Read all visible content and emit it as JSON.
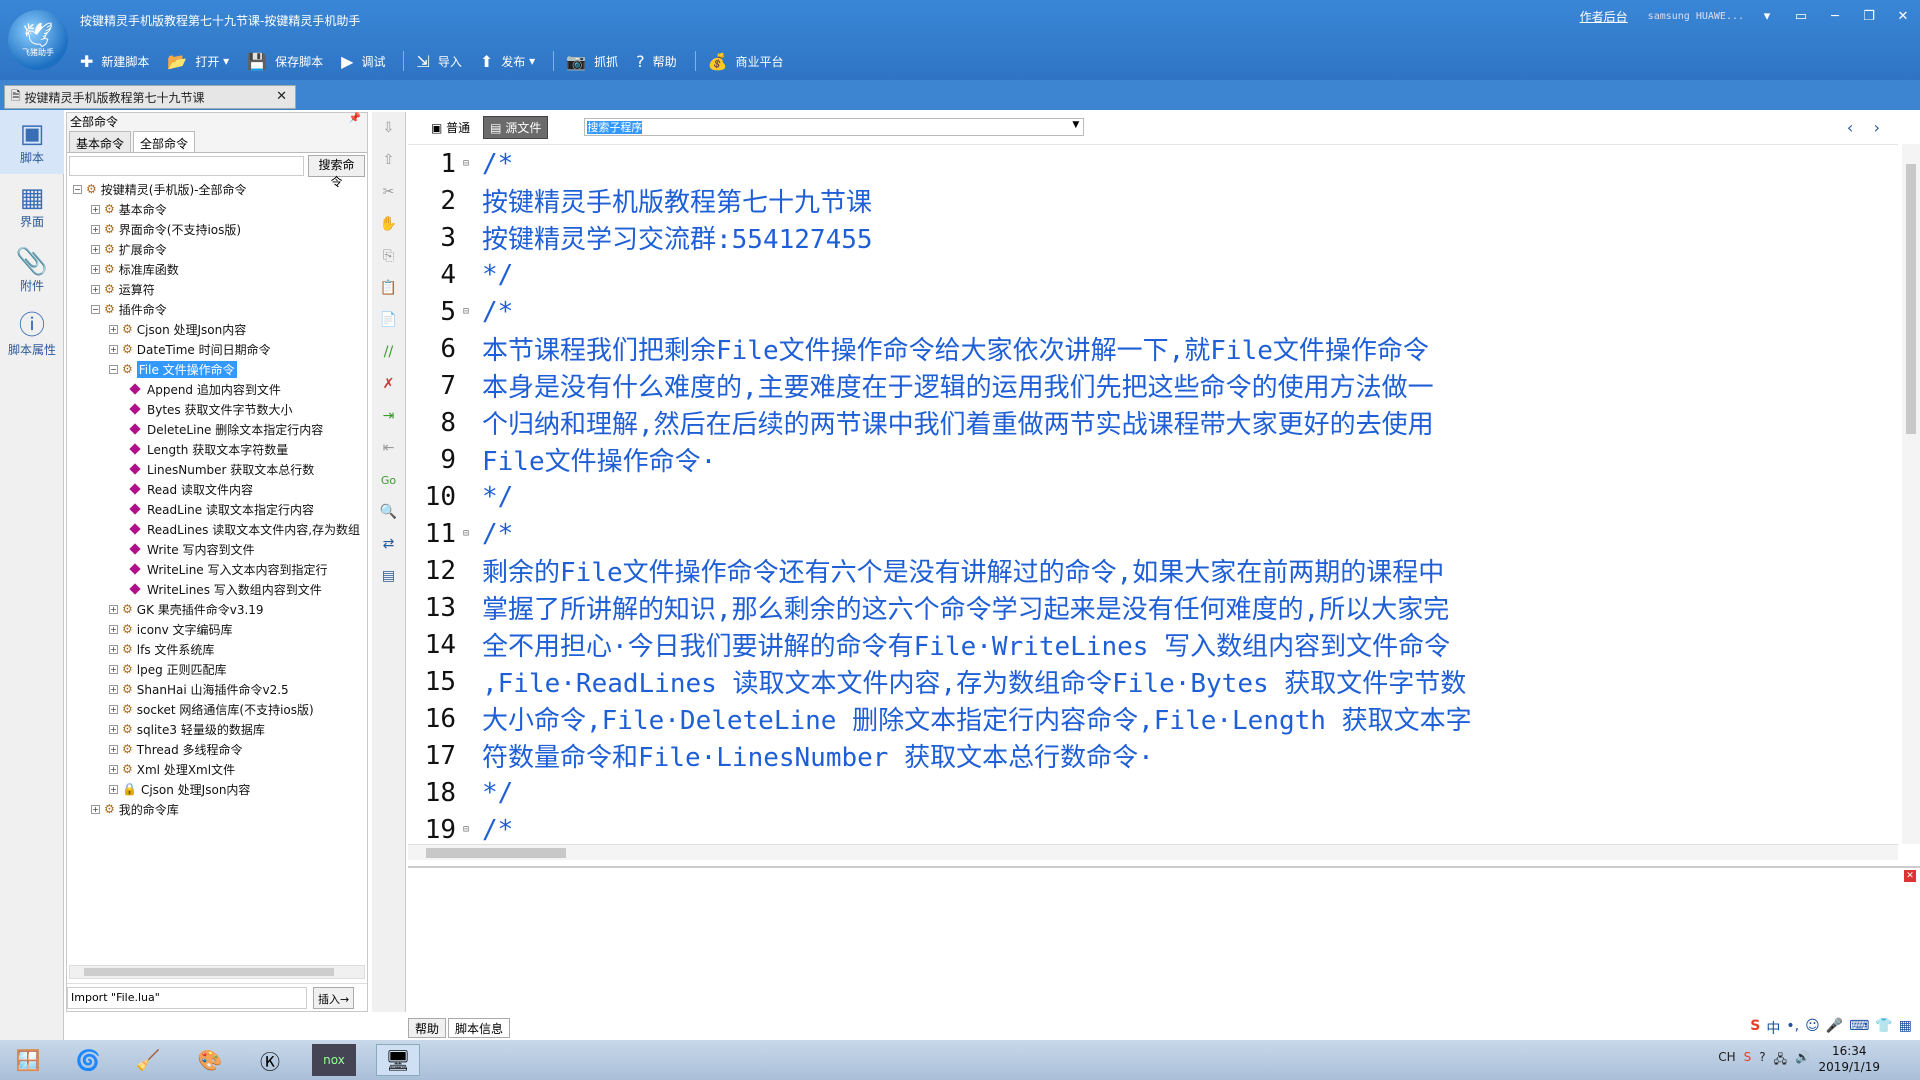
{
  "window": {
    "title": "按键精灵手机版教程第七十九节课-按键精灵手机助手",
    "logo_text": "飞猪助手",
    "author_link": "作者后台",
    "device": "samsung HUAWE...",
    "min": "─",
    "restore": "❐",
    "max": "□",
    "close": "✕",
    "extra": "▭"
  },
  "toolbar": {
    "new": "新建脚本",
    "open": "打开",
    "save": "保存脚本",
    "debug": "调试",
    "import": "导入",
    "publish": "发布",
    "capture": "抓抓",
    "help": "帮助",
    "market": "商业平台"
  },
  "doc_tab": {
    "label": "按键精灵手机版教程第七十九节课"
  },
  "rail": {
    "script": "脚本",
    "ui": "界面",
    "attach": "附件",
    "props": "脚本属性"
  },
  "commands": {
    "header": "全部命令",
    "tab_basic": "基本命令",
    "tab_all": "全部命令",
    "search_button": "搜索命令",
    "tree": [
      {
        "label": "按键精灵(手机版)-全部命令",
        "level": 0,
        "type": "root"
      },
      {
        "label": "基本命令",
        "level": 1,
        "type": "folder"
      },
      {
        "label": "界面命令(不支持ios版)",
        "level": 1,
        "type": "folder"
      },
      {
        "label": "扩展命令",
        "level": 1,
        "type": "folder"
      },
      {
        "label": "标准库函数",
        "level": 1,
        "type": "folder"
      },
      {
        "label": "运算符",
        "level": 1,
        "type": "folder"
      },
      {
        "label": "插件命令",
        "level": 1,
        "type": "open"
      },
      {
        "label": "Cjson 处理Json内容",
        "level": 2,
        "type": "folder"
      },
      {
        "label": "DateTime 时间日期命令",
        "level": 2,
        "type": "folder"
      },
      {
        "label": "File 文件操作命令",
        "level": 2,
        "type": "selected"
      },
      {
        "label": "Append 追加内容到文件",
        "level": 3,
        "type": "leaf"
      },
      {
        "label": "Bytes 获取文件字节数大小",
        "level": 3,
        "type": "leaf"
      },
      {
        "label": "DeleteLine 删除文本指定行内容",
        "level": 3,
        "type": "leaf"
      },
      {
        "label": "Length 获取文本字符数量",
        "level": 3,
        "type": "leaf"
      },
      {
        "label": "LinesNumber 获取文本总行数",
        "level": 3,
        "type": "leaf"
      },
      {
        "label": "Read 读取文件内容",
        "level": 3,
        "type": "leaf"
      },
      {
        "label": "ReadLine 读取文本指定行内容",
        "level": 3,
        "type": "leaf"
      },
      {
        "label": "ReadLines 读取文本文件内容,存为数组",
        "level": 3,
        "type": "leaf"
      },
      {
        "label": "Write 写内容到文件",
        "level": 3,
        "type": "leaf"
      },
      {
        "label": "WriteLine 写入文本内容到指定行",
        "level": 3,
        "type": "leaf"
      },
      {
        "label": "WriteLines 写入数组内容到文件",
        "level": 3,
        "type": "leaf"
      },
      {
        "label": "GK 果壳插件命令v3.19",
        "level": 2,
        "type": "folder"
      },
      {
        "label": "iconv 文字编码库",
        "level": 2,
        "type": "folder"
      },
      {
        "label": "lfs 文件系统库",
        "level": 2,
        "type": "folder"
      },
      {
        "label": "lpeg 正则匹配库",
        "level": 2,
        "type": "folder"
      },
      {
        "label": "ShanHai 山海插件命令v2.5",
        "level": 2,
        "type": "folder"
      },
      {
        "label": "socket 网络通信库(不支持ios版)",
        "level": 2,
        "type": "folder"
      },
      {
        "label": "sqlite3 轻量级的数据库",
        "level": 2,
        "type": "folder"
      },
      {
        "label": "Thread 多线程命令",
        "level": 2,
        "type": "folder"
      },
      {
        "label": "Xml 处理Xml文件",
        "level": 2,
        "type": "folder"
      },
      {
        "label": "Cjson 处理Json内容",
        "level": 2,
        "type": "lock"
      },
      {
        "label": "我的命令库",
        "level": 1,
        "type": "folder"
      }
    ],
    "import_text": "Import \"File.lua\"",
    "insert_button": "插入→"
  },
  "editor": {
    "mode_normal": "普通",
    "mode_source": "源文件",
    "func_select": "搜索子程序",
    "lines": [
      {
        "n": "1",
        "fold": "⊟",
        "text": "/*"
      },
      {
        "n": "2",
        "fold": "",
        "text": "按键精灵手机版教程第七十九节课"
      },
      {
        "n": "3",
        "fold": "",
        "text": "按键精灵学习交流群:554127455"
      },
      {
        "n": "4",
        "fold": "",
        "text": "*/"
      },
      {
        "n": "5",
        "fold": "⊟",
        "text": "/*"
      },
      {
        "n": "6",
        "fold": "",
        "text": "本节课程我们把剩余File文件操作命令给大家依次讲解一下,就File文件操作命令"
      },
      {
        "n": "7",
        "fold": "",
        "text": "本身是没有什么难度的,主要难度在于逻辑的运用我们先把这些命令的使用方法做一"
      },
      {
        "n": "8",
        "fold": "",
        "text": "个归纳和理解,然后在后续的两节课中我们着重做两节实战课程带大家更好的去使用"
      },
      {
        "n": "9",
        "fold": "",
        "text": "File文件操作命令·"
      },
      {
        "n": "10",
        "fold": "",
        "text": "*/"
      },
      {
        "n": "11",
        "fold": "⊟",
        "text": "/*"
      },
      {
        "n": "12",
        "fold": "",
        "text": "剩余的File文件操作命令还有六个是没有讲解过的命令,如果大家在前两期的课程中"
      },
      {
        "n": "13",
        "fold": "",
        "text": "掌握了所讲解的知识,那么剩余的这六个命令学习起来是没有任何难度的,所以大家完"
      },
      {
        "n": "14",
        "fold": "",
        "text": "全不用担心·今日我们要讲解的命令有File·WriteLines 写入数组内容到文件命令"
      },
      {
        "n": "15",
        "fold": "",
        "text": ",File·ReadLines 读取文本文件内容,存为数组命令File·Bytes 获取文件字节数"
      },
      {
        "n": "16",
        "fold": "",
        "text": "大小命令,File·DeleteLine 删除文本指定行内容命令,File·Length 获取文本字"
      },
      {
        "n": "17",
        "fold": "",
        "text": "符数量命令和File·LinesNumber 获取文本总行数命令·"
      },
      {
        "n": "18",
        "fold": "",
        "text": "*/"
      },
      {
        "n": "19",
        "fold": "⊟",
        "text": "/*"
      }
    ]
  },
  "bottom": {
    "tab_help": "帮助",
    "tab_info": "脚本信息"
  },
  "taskbar": {
    "time": "16:34",
    "date": "2019/1/19",
    "lang": "CH"
  },
  "colors": {
    "accent": "#2f74c4",
    "code": "#1f5fd6",
    "selection": "#3399ff"
  }
}
